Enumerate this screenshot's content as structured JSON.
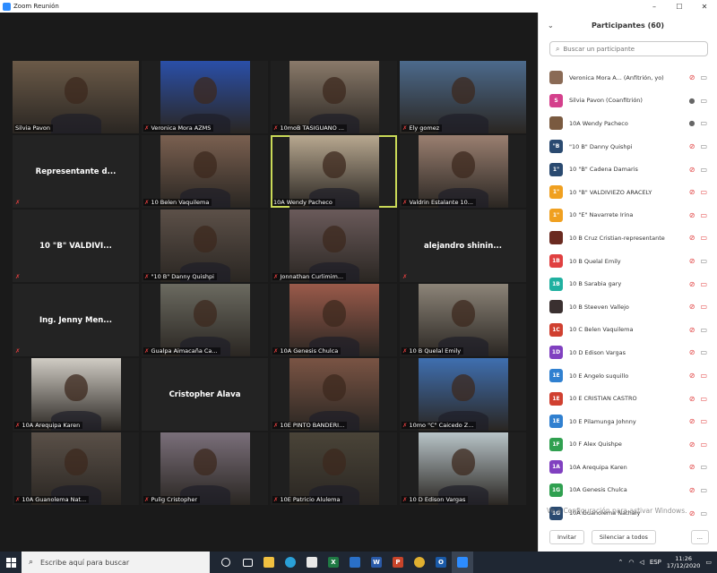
{
  "window": {
    "title": "Zoom Reunión",
    "btn_min": "–",
    "btn_max": "☐",
    "btn_close": "✕"
  },
  "tiles": [
    {
      "label": "Silvia Pavon",
      "type": "video",
      "bg": "#6b5a48",
      "muted": false
    },
    {
      "label": "Veronica Mora AZMS",
      "type": "video",
      "bg": "#2a4fa8",
      "muted": true
    },
    {
      "label": "10moB TASIGUANO ...",
      "type": "video",
      "bg": "#8a7a6a",
      "muted": true
    },
    {
      "label": "Ely gomez",
      "type": "video",
      "bg": "#4c6a8c",
      "muted": true
    },
    {
      "label": "Representante d...",
      "type": "name",
      "muted": true
    },
    {
      "label": "10 Belen Vaquilema",
      "type": "video",
      "bg": "#7a6050",
      "muted": true
    },
    {
      "label": "10A Wendy Pacheco",
      "type": "video",
      "bg": "#b8a890",
      "muted": false,
      "active": true
    },
    {
      "label": "Valdrin Estalante 10...",
      "type": "video",
      "bg": "#9a7f70",
      "muted": true
    },
    {
      "label": "10 \"B\" VALDIVI...",
      "type": "name",
      "muted": true
    },
    {
      "label": "\"10 B\" Danny Quishpi",
      "type": "video",
      "bg": "#5c5048",
      "muted": true
    },
    {
      "label": "Jonnathan Curlimim...",
      "type": "video",
      "bg": "#6a5a5a",
      "muted": true
    },
    {
      "label": "alejandro shinin...",
      "type": "name",
      "muted": true
    },
    {
      "label": "Ing. Jenny Men...",
      "type": "name",
      "muted": true
    },
    {
      "label": "Gualpa Aimacaña Ca...",
      "type": "video",
      "bg": "#6b6a60",
      "muted": true
    },
    {
      "label": "10A Genesis Chulca",
      "type": "video",
      "bg": "#9a5a4a",
      "muted": true
    },
    {
      "label": "10 B Quelal Emily",
      "type": "video",
      "bg": "#8c8478",
      "muted": true
    },
    {
      "label": "10A Arequipa Karen",
      "type": "video",
      "bg": "#d0ccc4",
      "muted": true
    },
    {
      "label": "Cristopher Alava",
      "type": "name",
      "muted": false
    },
    {
      "label": "10E PINTO BANDERI...",
      "type": "video",
      "bg": "#7a5444",
      "muted": true
    },
    {
      "label": "10mo \"C\" Caicedo Z...",
      "type": "video",
      "bg": "#3f6fb0",
      "muted": true
    },
    {
      "label": "10A Guanolema Nat...",
      "type": "video",
      "bg": "#5a5048",
      "muted": true
    },
    {
      "label": "Pulig Cristopher",
      "type": "video",
      "bg": "#7a6f7a",
      "muted": true
    },
    {
      "label": "10E Patricio Alulema",
      "type": "video",
      "bg": "#4a4438",
      "muted": true
    },
    {
      "label": "10 D Edison Vargas",
      "type": "video",
      "bg": "#b8c4c8",
      "muted": true
    }
  ],
  "panel": {
    "title": "Participantes (60)",
    "search_placeholder": "Buscar un participante",
    "invite": "Invitar",
    "mute_all": "Silenciar a todos",
    "more": "..."
  },
  "participants": [
    {
      "initials": "",
      "color": "#8a6a55",
      "name": "Veronica Mora A... (Anfitrión, yo)",
      "mic": "off",
      "cam": "on"
    },
    {
      "initials": "S",
      "color": "#d4408c",
      "name": "Silvia Pavon (Coanfitrión)",
      "mic": "on",
      "cam": "on"
    },
    {
      "initials": "",
      "color": "#7a5a40",
      "name": "10A Wendy Pacheco",
      "mic": "on",
      "cam": "on"
    },
    {
      "initials": "\"B",
      "color": "#2a4a70",
      "name": "\"10 B\" Danny Quishpi",
      "mic": "off",
      "cam": "on"
    },
    {
      "initials": "1\"",
      "color": "#2a4a70",
      "name": "10 \"B\" Cadena Damaris",
      "mic": "off",
      "cam": "on"
    },
    {
      "initials": "1\"",
      "color": "#f0a020",
      "name": "10 \"B\" VALDIVIEZO ARACELY",
      "mic": "off",
      "cam": "off"
    },
    {
      "initials": "1\"",
      "color": "#f0a020",
      "name": "10 \"E\"  Navarrete Irina",
      "mic": "off",
      "cam": "off"
    },
    {
      "initials": "",
      "color": "#6a2a20",
      "name": "10 B Cruz Cristian-representante",
      "mic": "off",
      "cam": "off"
    },
    {
      "initials": "1B",
      "color": "#e04040",
      "name": "10 B Quelal Emily",
      "mic": "off",
      "cam": "on"
    },
    {
      "initials": "1B",
      "color": "#20b0a0",
      "name": "10 B Sarabia gary",
      "mic": "off",
      "cam": "off"
    },
    {
      "initials": "",
      "color": "#3a3030",
      "name": "10 B Steeven Vallejo",
      "mic": "off",
      "cam": "off"
    },
    {
      "initials": "1C",
      "color": "#d04030",
      "name": "10 C Belen Vaquilema",
      "mic": "off",
      "cam": "on"
    },
    {
      "initials": "1D",
      "color": "#8040c0",
      "name": "10 D Edison Vargas",
      "mic": "off",
      "cam": "on"
    },
    {
      "initials": "1E",
      "color": "#3080d0",
      "name": "10 E Angelo  suquillo",
      "mic": "off",
      "cam": "off"
    },
    {
      "initials": "1E",
      "color": "#d04030",
      "name": "10 E CRISTIAN CASTRO",
      "mic": "off",
      "cam": "off"
    },
    {
      "initials": "1E",
      "color": "#3080d0",
      "name": "10 E Pilamunga Johnny",
      "mic": "off",
      "cam": "off"
    },
    {
      "initials": "1F",
      "color": "#30a050",
      "name": "10 F Alex Quishpe",
      "mic": "off",
      "cam": "off"
    },
    {
      "initials": "1A",
      "color": "#8040c0",
      "name": "10A Arequipa Karen",
      "mic": "off",
      "cam": "on"
    },
    {
      "initials": "1G",
      "color": "#30a050",
      "name": "10A Genesis Chulca",
      "mic": "off",
      "cam": "on"
    },
    {
      "initials": "1G",
      "color": "#2a4a70",
      "name": "10A Guanolema Nathaly",
      "mic": "off",
      "cam": "on"
    }
  ],
  "activation_text": "Ve a Configuración para activar Windows.",
  "taskbar": {
    "search_placeholder": "Escribe aquí para buscar",
    "lang": "ESP",
    "time": "11:26",
    "date": "17/12/2020"
  }
}
